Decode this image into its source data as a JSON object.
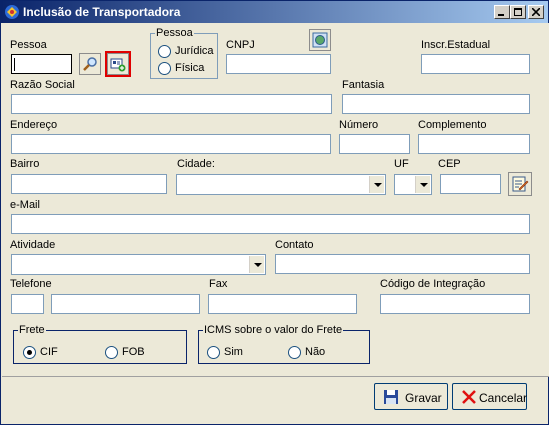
{
  "window": {
    "title": "Inclusão de Transportadora",
    "icon": "app-icon",
    "controls": [
      "minimize-icon",
      "maximize-icon",
      "close-icon"
    ]
  },
  "form": {
    "pessoa_label": "Pessoa",
    "pessoa_value": "",
    "pessoa_group": {
      "title": "Pessoa",
      "options": [
        "Jurídica",
        "Física"
      ],
      "selected": null
    },
    "cnpj_label": "CNPJ",
    "cnpj_value": "",
    "inscr_estadual_label": "Inscr.Estadual",
    "inscr_estadual_value": "",
    "razao_social_label": "Razão Social",
    "razao_social_value": "",
    "fantasia_label": "Fantasia",
    "fantasia_value": "",
    "endereco_label": "Endereço",
    "endereco_value": "",
    "numero_label": "Número",
    "numero_value": "",
    "complemento_label": "Complemento",
    "complemento_value": "",
    "bairro_label": "Bairro",
    "bairro_value": "",
    "cidade_label": "Cidade:",
    "cidade_value": "",
    "uf_label": "UF",
    "uf_value": "",
    "cep_label": "CEP",
    "cep_value": "",
    "email_label": "e-Mail",
    "email_value": "",
    "atividade_label": "Atividade",
    "atividade_value": "",
    "contato_label": "Contato",
    "contato_value": "",
    "telefone_label": "Telefone",
    "telefone_ddd_value": "",
    "telefone_value": "",
    "fax_label": "Fax",
    "fax_value": "",
    "codigo_integracao_label": "Código de Integração",
    "codigo_integracao_value": "",
    "frete_group": {
      "title": "Frete",
      "options": [
        "CIF",
        "FOB"
      ],
      "selected": "CIF"
    },
    "icms_group": {
      "title": "ICMS sobre o valor do Frete",
      "options": [
        "Sim",
        "Não"
      ],
      "selected": null
    }
  },
  "footer": {
    "save_label": "Gravar",
    "cancel_label": "Cancelar"
  },
  "colors": {
    "titlebar_start": "#0a246a",
    "titlebar_end": "#a6caf0",
    "highlight": "#e00000",
    "panel_bg": "#ece9d8"
  }
}
